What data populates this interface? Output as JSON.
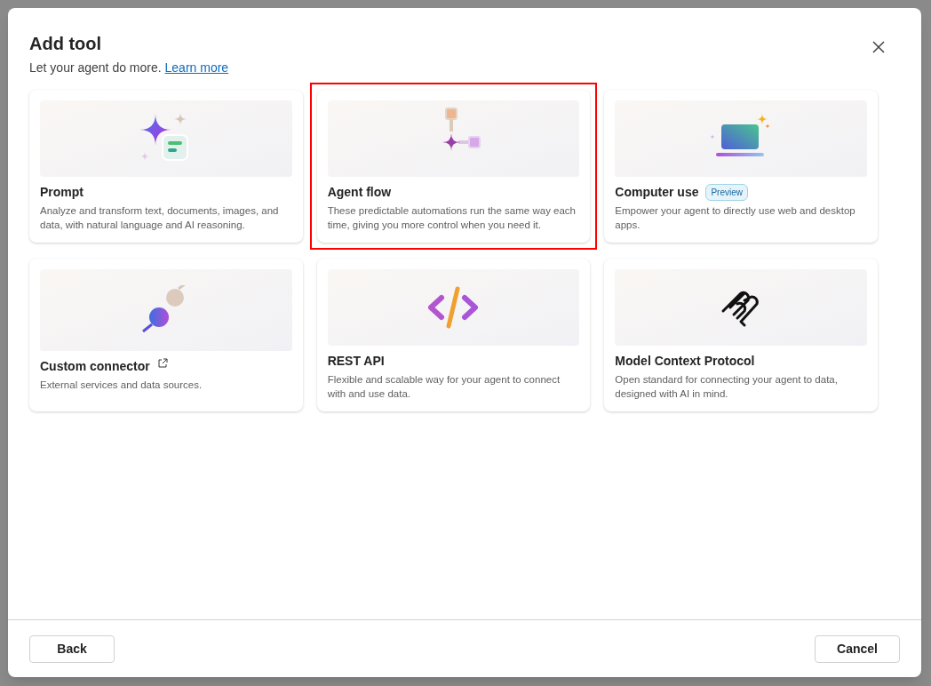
{
  "dialog": {
    "title": "Add tool",
    "subtitle": "Let your agent do more.",
    "link": "Learn more"
  },
  "cards": [
    {
      "title": "Prompt",
      "description": "Analyze and transform text, documents, images, and data, with natural language and AI reasoning.",
      "highlighted": false,
      "external_link": false
    },
    {
      "title": "Agent flow",
      "description": "These predictable automations run the same way each time, giving you more control when you need it.",
      "highlighted": true,
      "external_link": false
    },
    {
      "title": "Computer use",
      "badge": "Preview",
      "description": "Empower your agent to directly use web and desktop apps.",
      "highlighted": false,
      "external_link": false
    },
    {
      "title": "Custom connector",
      "description": "External services and data sources.",
      "highlighted": false,
      "external_link": true
    },
    {
      "title": "REST API",
      "description": "Flexible and scalable way for your agent to connect with and use data.",
      "highlighted": false,
      "external_link": false
    },
    {
      "title": "Model Context Protocol",
      "description": "Open standard for connecting your agent to data, designed with AI in mind.",
      "highlighted": false,
      "external_link": false
    }
  ],
  "footer": {
    "back": "Back",
    "cancel": "Cancel"
  }
}
